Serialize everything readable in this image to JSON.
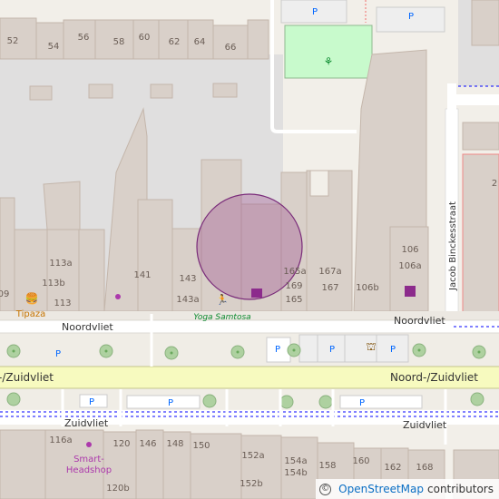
{
  "streets": {
    "noordvliet_left": "Noordvliet",
    "noordvliet_right": "Noordvliet",
    "noord_zuidvliet_left": "-/Zuidvliet",
    "noord_zuidvliet_right": "Noord-/Zuidvliet",
    "zuidvliet_left": "Zuidvliet",
    "zuidvliet_right": "Zuidvliet",
    "jacob": "Jacob Binckesstraat"
  },
  "pois": {
    "tipaza": "Tipaza",
    "yoga": "Yoga Samtosa",
    "smart_line1": "Smart-",
    "smart_line2": "Headshop"
  },
  "house_numbers": {
    "h52": "52",
    "h54": "54",
    "h56": "56",
    "h58": "58",
    "h60": "60",
    "h62": "62",
    "h64": "64",
    "h66": "66",
    "h113a": "113a",
    "h113b": "113b",
    "h113": "113",
    "h09": "09",
    "h141": "141",
    "h143": "143",
    "h143a": "143a",
    "h165a": "165a",
    "h167a": "167a",
    "h169": "169",
    "h167": "167",
    "h165": "165",
    "h106": "106",
    "h106a": "106a",
    "h106b": "106b",
    "h2": "2",
    "h116a": "116a",
    "h120": "120",
    "h146": "146",
    "h148": "148",
    "h150": "150",
    "h152a": "152a",
    "h154a": "154a",
    "h154b": "154b",
    "h158": "158",
    "h160": "160",
    "h162": "162",
    "h168": "168",
    "h152b": "152b",
    "h120b": "120b"
  },
  "parking": {
    "label": "P"
  },
  "attribution": {
    "symbol": "©",
    "link": "OpenStreetMap",
    "suffix": "contributors"
  },
  "colors": {
    "building": "#d9d0c9",
    "building_stroke": "#c4b6ab",
    "residential": "#e0dfdf",
    "road_major": "#f7fabf",
    "road_minor": "#ffffff",
    "park": "#c8facc",
    "highlight_fill": "#9b4a8d",
    "tree": "#aed1a0",
    "cycleway": "#0000ff",
    "parking_blue": "#0066ff"
  }
}
